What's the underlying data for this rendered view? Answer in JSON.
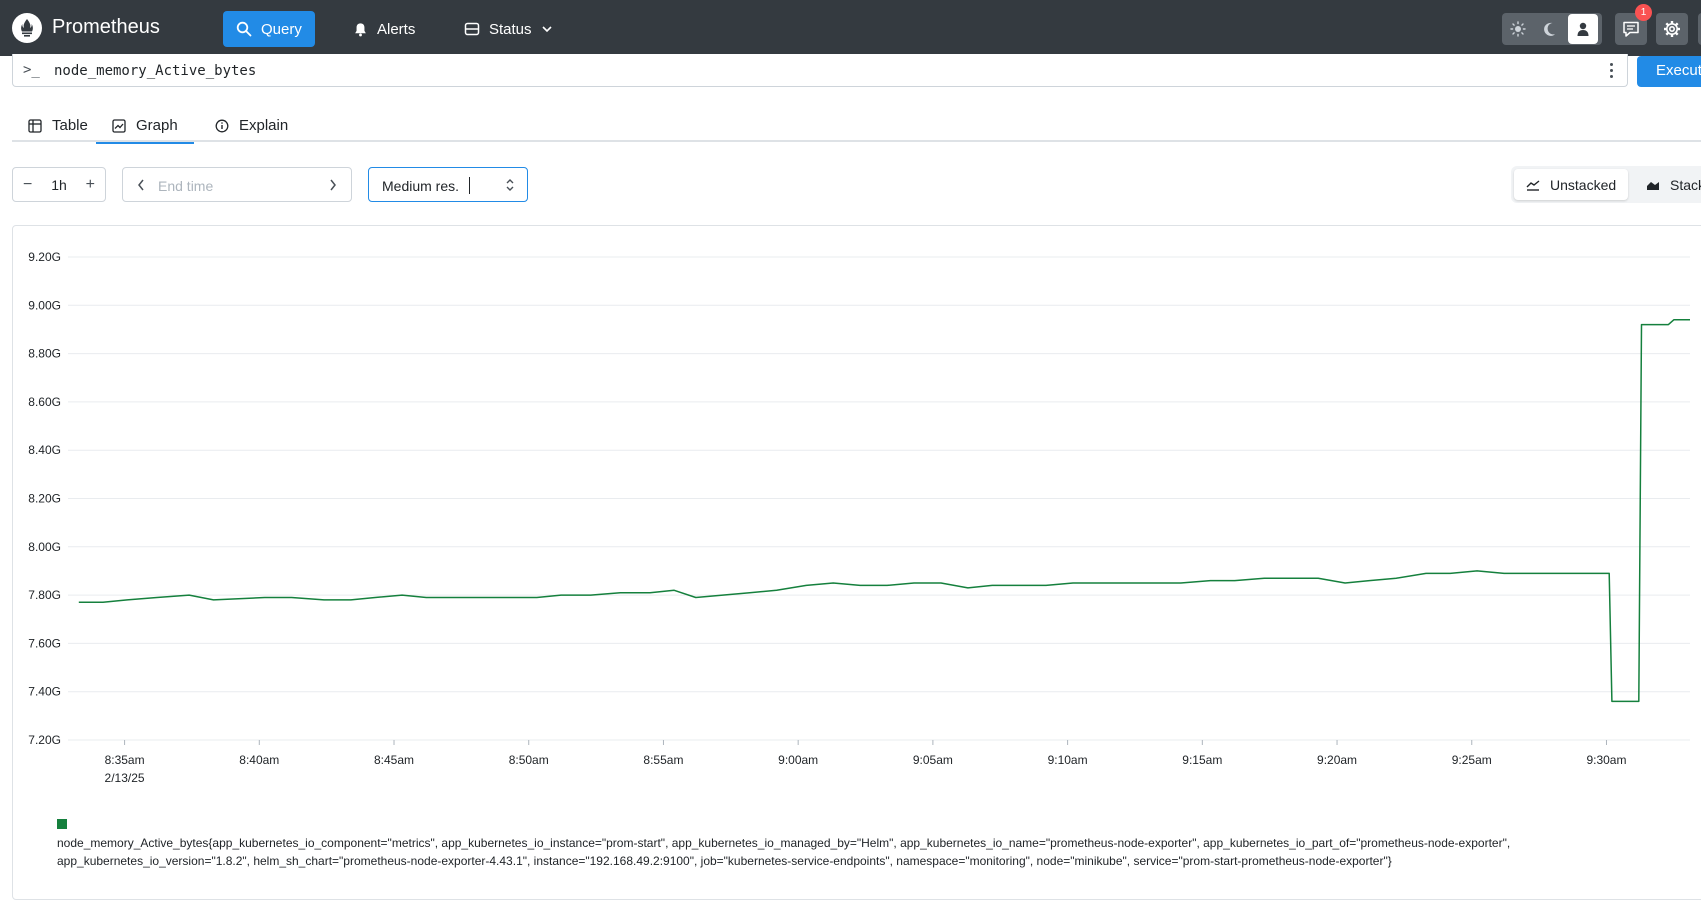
{
  "header": {
    "brand": "Prometheus",
    "nav": [
      {
        "label": "Query",
        "icon": "search-icon",
        "active": true
      },
      {
        "label": "Alerts",
        "icon": "bell-icon",
        "active": false
      },
      {
        "label": "Status",
        "icon": "server-icon",
        "active": false,
        "dropdown": true
      }
    ],
    "theme_options": [
      "light",
      "dark",
      "auto"
    ],
    "theme_selected": "auto",
    "notification_count": "1",
    "colors": {
      "bar": "#343a40",
      "accent": "#228be6",
      "badge": "#fa5252"
    }
  },
  "query": {
    "expression": "node_memory_Active_bytes",
    "execute_label": "Execute",
    "prompt_icon": "terminal-prompt-icon"
  },
  "tabs": [
    {
      "label": "Table",
      "icon": "table-icon",
      "active": false
    },
    {
      "label": "Graph",
      "icon": "graph-icon",
      "active": true
    },
    {
      "label": "Explain",
      "icon": "info-icon",
      "active": false
    }
  ],
  "controls": {
    "range": "1h",
    "end_time_placeholder": "End time",
    "resolution": "Medium res.",
    "stacking": [
      {
        "label": "Unstacked",
        "active": true
      },
      {
        "label": "Stacked",
        "active": false
      }
    ]
  },
  "chart_data": {
    "type": "line",
    "title": "",
    "xlabel": "",
    "ylabel": "",
    "x_ticks": [
      {
        "label": "8:35am",
        "sublabel": "2/13/25",
        "t": 35
      },
      {
        "label": "8:40am",
        "t": 40
      },
      {
        "label": "8:45am",
        "t": 45
      },
      {
        "label": "8:50am",
        "t": 50
      },
      {
        "label": "8:55am",
        "t": 55
      },
      {
        "label": "9:00am",
        "t": 60
      },
      {
        "label": "9:05am",
        "t": 65
      },
      {
        "label": "9:10am",
        "t": 70
      },
      {
        "label": "9:15am",
        "t": 75
      },
      {
        "label": "9:20am",
        "t": 80
      },
      {
        "label": "9:25am",
        "t": 85
      },
      {
        "label": "9:30am",
        "t": 90
      }
    ],
    "y_ticks": [
      "9.20G",
      "9.00G",
      "8.80G",
      "8.60G",
      "8.40G",
      "8.20G",
      "8.00G",
      "7.80G",
      "7.60G",
      "7.40G",
      "7.20G"
    ],
    "xlim": [
      32.9,
      93.1
    ],
    "ylim": [
      7.2,
      9.2
    ],
    "grid": true,
    "series": [
      {
        "name": "node_memory_Active_bytes{app_kubernetes_io_component=\"metrics\", app_kubernetes_io_instance=\"prom-start\", app_kubernetes_io_managed_by=\"Helm\", app_kubernetes_io_name=\"prometheus-node-exporter\", app_kubernetes_io_part_of=\"prometheus-node-exporter\", app_kubernetes_io_version=\"1.8.2\", helm_sh_chart=\"prometheus-node-exporter-4.43.1\", instance=\"192.168.49.2:9100\", job=\"kubernetes-service-endpoints\", namespace=\"monitoring\", node=\"minikube\", service=\"prom-start-prometheus-node-exporter\"}",
        "color": "#15803d",
        "points": [
          [
            33.3,
            7.77
          ],
          [
            34.2,
            7.77
          ],
          [
            35.1,
            7.78
          ],
          [
            36.2,
            7.79
          ],
          [
            37.4,
            7.8
          ],
          [
            38.3,
            7.78
          ],
          [
            40.2,
            7.79
          ],
          [
            41.2,
            7.79
          ],
          [
            42.4,
            7.78
          ],
          [
            43.4,
            7.78
          ],
          [
            44.3,
            7.79
          ],
          [
            45.3,
            7.8
          ],
          [
            46.2,
            7.79
          ],
          [
            47.3,
            7.79
          ],
          [
            49.2,
            7.79
          ],
          [
            50.3,
            7.79
          ],
          [
            51.2,
            7.8
          ],
          [
            52.3,
            7.8
          ],
          [
            53.4,
            7.81
          ],
          [
            54.5,
            7.81
          ],
          [
            55.4,
            7.82
          ],
          [
            56.2,
            7.79
          ],
          [
            57.2,
            7.8
          ],
          [
            58.2,
            7.81
          ],
          [
            59.2,
            7.82
          ],
          [
            60.3,
            7.84
          ],
          [
            61.3,
            7.85
          ],
          [
            62.3,
            7.84
          ],
          [
            63.3,
            7.84
          ],
          [
            64.3,
            7.85
          ],
          [
            65.3,
            7.85
          ],
          [
            66.3,
            7.83
          ],
          [
            67.2,
            7.84
          ],
          [
            68.2,
            7.84
          ],
          [
            69.2,
            7.84
          ],
          [
            70.2,
            7.85
          ],
          [
            71.2,
            7.85
          ],
          [
            72.2,
            7.85
          ],
          [
            73.2,
            7.85
          ],
          [
            74.2,
            7.85
          ],
          [
            75.3,
            7.86
          ],
          [
            76.2,
            7.86
          ],
          [
            77.3,
            7.87
          ],
          [
            78.2,
            7.87
          ],
          [
            79.3,
            7.87
          ],
          [
            80.3,
            7.85
          ],
          [
            81.2,
            7.86
          ],
          [
            82.2,
            7.87
          ],
          [
            83.3,
            7.89
          ],
          [
            84.2,
            7.89
          ],
          [
            85.2,
            7.9
          ],
          [
            86.2,
            7.89
          ],
          [
            90.1,
            7.89
          ],
          [
            90.2,
            7.36
          ],
          [
            91.2,
            7.36
          ],
          [
            91.3,
            8.92
          ],
          [
            92.3,
            8.92
          ],
          [
            92.5,
            8.94
          ],
          [
            93.1,
            8.94
          ]
        ]
      }
    ]
  }
}
